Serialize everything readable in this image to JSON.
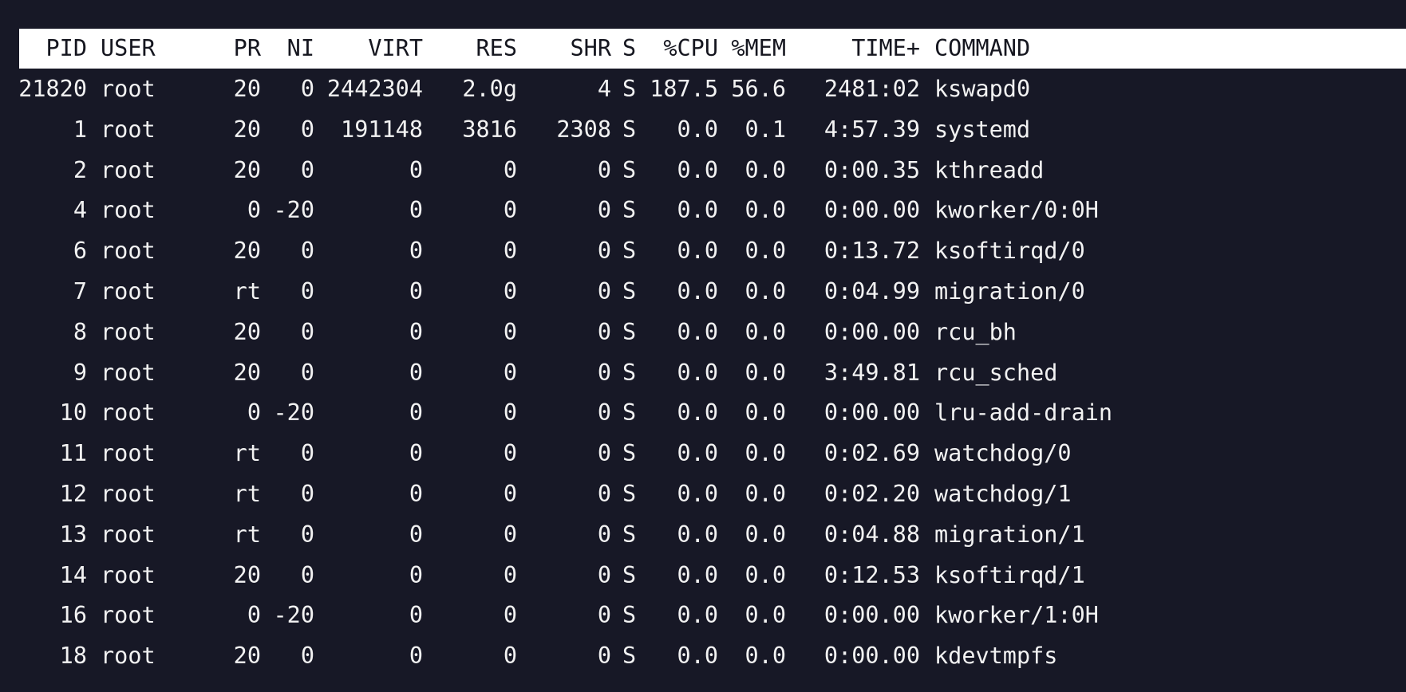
{
  "header": {
    "pid": "PID",
    "user": "USER",
    "pr": "PR",
    "ni": "NI",
    "virt": "VIRT",
    "res": "RES",
    "shr": "SHR",
    "s": "S",
    "cpu": "%CPU",
    "mem": "%MEM",
    "time": "TIME+",
    "command": "COMMAND"
  },
  "processes": [
    {
      "pid": "21820",
      "user": "root",
      "pr": "20",
      "ni": "0",
      "virt": "2442304",
      "res": "2.0g",
      "shr": "4",
      "s": "S",
      "cpu": "187.5",
      "mem": "56.6",
      "time": "2481:02",
      "command": "kswapd0"
    },
    {
      "pid": "1",
      "user": "root",
      "pr": "20",
      "ni": "0",
      "virt": "191148",
      "res": "3816",
      "shr": "2308",
      "s": "S",
      "cpu": "0.0",
      "mem": "0.1",
      "time": "4:57.39",
      "command": "systemd"
    },
    {
      "pid": "2",
      "user": "root",
      "pr": "20",
      "ni": "0",
      "virt": "0",
      "res": "0",
      "shr": "0",
      "s": "S",
      "cpu": "0.0",
      "mem": "0.0",
      "time": "0:00.35",
      "command": "kthreadd"
    },
    {
      "pid": "4",
      "user": "root",
      "pr": "0",
      "ni": "-20",
      "virt": "0",
      "res": "0",
      "shr": "0",
      "s": "S",
      "cpu": "0.0",
      "mem": "0.0",
      "time": "0:00.00",
      "command": "kworker/0:0H"
    },
    {
      "pid": "6",
      "user": "root",
      "pr": "20",
      "ni": "0",
      "virt": "0",
      "res": "0",
      "shr": "0",
      "s": "S",
      "cpu": "0.0",
      "mem": "0.0",
      "time": "0:13.72",
      "command": "ksoftirqd/0"
    },
    {
      "pid": "7",
      "user": "root",
      "pr": "rt",
      "ni": "0",
      "virt": "0",
      "res": "0",
      "shr": "0",
      "s": "S",
      "cpu": "0.0",
      "mem": "0.0",
      "time": "0:04.99",
      "command": "migration/0"
    },
    {
      "pid": "8",
      "user": "root",
      "pr": "20",
      "ni": "0",
      "virt": "0",
      "res": "0",
      "shr": "0",
      "s": "S",
      "cpu": "0.0",
      "mem": "0.0",
      "time": "0:00.00",
      "command": "rcu_bh"
    },
    {
      "pid": "9",
      "user": "root",
      "pr": "20",
      "ni": "0",
      "virt": "0",
      "res": "0",
      "shr": "0",
      "s": "S",
      "cpu": "0.0",
      "mem": "0.0",
      "time": "3:49.81",
      "command": "rcu_sched"
    },
    {
      "pid": "10",
      "user": "root",
      "pr": "0",
      "ni": "-20",
      "virt": "0",
      "res": "0",
      "shr": "0",
      "s": "S",
      "cpu": "0.0",
      "mem": "0.0",
      "time": "0:00.00",
      "command": "lru-add-drain"
    },
    {
      "pid": "11",
      "user": "root",
      "pr": "rt",
      "ni": "0",
      "virt": "0",
      "res": "0",
      "shr": "0",
      "s": "S",
      "cpu": "0.0",
      "mem": "0.0",
      "time": "0:02.69",
      "command": "watchdog/0"
    },
    {
      "pid": "12",
      "user": "root",
      "pr": "rt",
      "ni": "0",
      "virt": "0",
      "res": "0",
      "shr": "0",
      "s": "S",
      "cpu": "0.0",
      "mem": "0.0",
      "time": "0:02.20",
      "command": "watchdog/1"
    },
    {
      "pid": "13",
      "user": "root",
      "pr": "rt",
      "ni": "0",
      "virt": "0",
      "res": "0",
      "shr": "0",
      "s": "S",
      "cpu": "0.0",
      "mem": "0.0",
      "time": "0:04.88",
      "command": "migration/1"
    },
    {
      "pid": "14",
      "user": "root",
      "pr": "20",
      "ni": "0",
      "virt": "0",
      "res": "0",
      "shr": "0",
      "s": "S",
      "cpu": "0.0",
      "mem": "0.0",
      "time": "0:12.53",
      "command": "ksoftirqd/1"
    },
    {
      "pid": "16",
      "user": "root",
      "pr": "0",
      "ni": "-20",
      "virt": "0",
      "res": "0",
      "shr": "0",
      "s": "S",
      "cpu": "0.0",
      "mem": "0.0",
      "time": "0:00.00",
      "command": "kworker/1:0H"
    },
    {
      "pid": "18",
      "user": "root",
      "pr": "20",
      "ni": "0",
      "virt": "0",
      "res": "0",
      "shr": "0",
      "s": "S",
      "cpu": "0.0",
      "mem": "0.0",
      "time": "0:00.00",
      "command": "kdevtmpfs"
    }
  ]
}
